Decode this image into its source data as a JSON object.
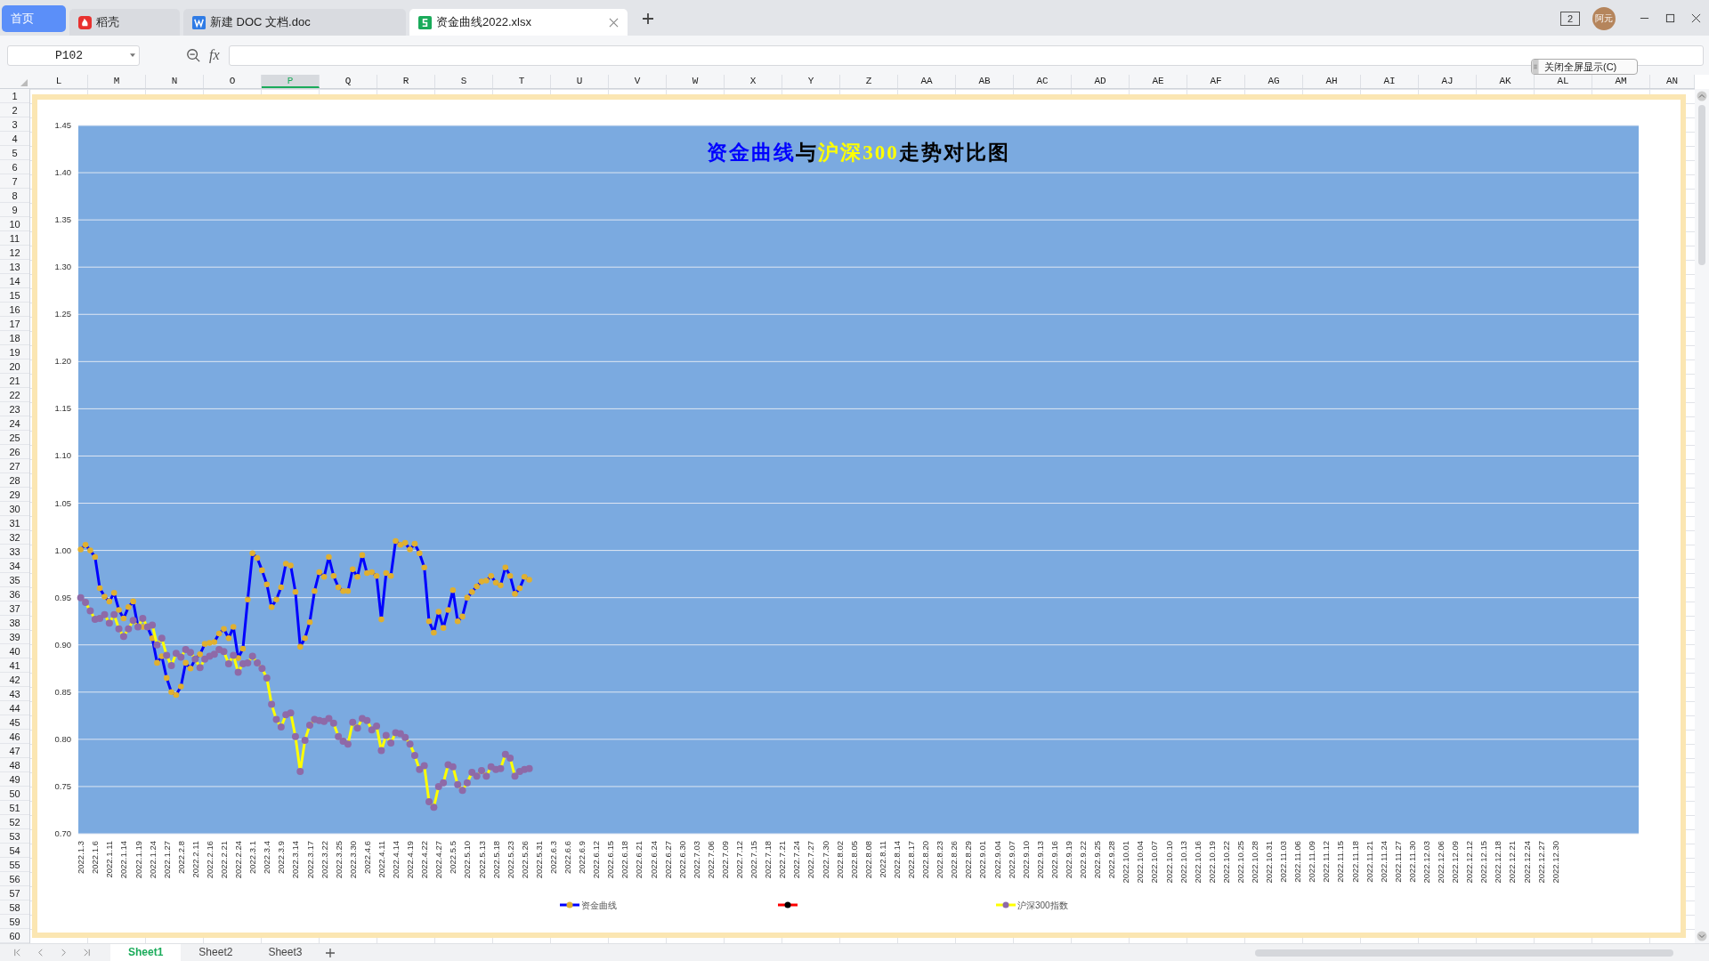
{
  "tabs": [
    {
      "label": "首页",
      "kind": "home",
      "selected": false
    },
    {
      "label": "稻壳",
      "kind": "docer",
      "selected": false
    },
    {
      "label": "新建 DOC 文档.doc",
      "kind": "writer",
      "selected": false
    },
    {
      "label": "资金曲线2022.xlsx",
      "kind": "sheet",
      "selected": true
    }
  ],
  "title_bar": {
    "window_count": "2",
    "user": "阿元"
  },
  "formula_bar": {
    "name_box": "P102",
    "function_label": "fx"
  },
  "popup": {
    "label": "关闭全屏显示(C)"
  },
  "columns": [
    {
      "label": "L",
      "selected": false
    },
    {
      "label": "M",
      "selected": false
    },
    {
      "label": "N",
      "selected": false
    },
    {
      "label": "O",
      "selected": false
    },
    {
      "label": "P",
      "selected": true
    },
    {
      "label": "Q",
      "selected": false
    },
    {
      "label": "R",
      "selected": false
    },
    {
      "label": "S",
      "selected": false
    },
    {
      "label": "T",
      "selected": false
    },
    {
      "label": "U",
      "selected": false
    },
    {
      "label": "V",
      "selected": false
    },
    {
      "label": "W",
      "selected": false
    },
    {
      "label": "X",
      "selected": false
    },
    {
      "label": "Y",
      "selected": false
    },
    {
      "label": "Z",
      "selected": false
    },
    {
      "label": "AA",
      "selected": false
    },
    {
      "label": "AB",
      "selected": false
    },
    {
      "label": "AC",
      "selected": false
    },
    {
      "label": "AD",
      "selected": false
    },
    {
      "label": "AE",
      "selected": false
    },
    {
      "label": "AF",
      "selected": false
    },
    {
      "label": "AG",
      "selected": false
    },
    {
      "label": "AH",
      "selected": false
    },
    {
      "label": "AI",
      "selected": false
    },
    {
      "label": "AJ",
      "selected": false
    },
    {
      "label": "AK",
      "selected": false
    },
    {
      "label": "AL",
      "selected": false
    },
    {
      "label": "AM",
      "selected": false
    },
    {
      "label": "AN",
      "selected": false
    }
  ],
  "rows": [
    "1",
    "2",
    "3",
    "4",
    "5",
    "6",
    "7",
    "8",
    "9",
    "10",
    "11",
    "12",
    "13",
    "14",
    "15",
    "16",
    "17",
    "18",
    "19",
    "20",
    "21",
    "22",
    "23",
    "24",
    "25",
    "26",
    "27",
    "28",
    "29",
    "30",
    "31",
    "32",
    "33",
    "34",
    "35",
    "36",
    "37",
    "38",
    "39",
    "40",
    "41",
    "42",
    "43",
    "44",
    "45",
    "46",
    "47",
    "48",
    "49",
    "50",
    "51",
    "52",
    "53",
    "54",
    "55",
    "56",
    "57",
    "58",
    "59",
    "60"
  ],
  "chart": {
    "title_parts": [
      {
        "text": "资金曲线",
        "color": "#0000ff"
      },
      {
        "text": "与",
        "color": "#000000"
      },
      {
        "text": "沪深300",
        "color": "#ffff00"
      },
      {
        "text": "走势对比图",
        "color": "#000000"
      }
    ],
    "chart_data": {
      "type": "line",
      "grid": true,
      "legend": true,
      "ylim": [
        0.7,
        1.45
      ],
      "yticks": [
        {
          "value": 0.7,
          "label": "0.70"
        },
        {
          "value": 0.75,
          "label": "0.75"
        },
        {
          "value": 0.8,
          "label": "0.80"
        },
        {
          "value": 0.85,
          "label": "0.85"
        },
        {
          "value": 0.9,
          "label": "0.90"
        },
        {
          "value": 0.95,
          "label": "0.95"
        },
        {
          "value": 1.0,
          "label": "1.00"
        },
        {
          "value": 1.05,
          "label": "1.05"
        },
        {
          "value": 1.1,
          "label": "1.10"
        },
        {
          "value": 1.15,
          "label": "1.15"
        },
        {
          "value": 1.2,
          "label": "1.20"
        },
        {
          "value": 1.25,
          "label": "1.25"
        },
        {
          "value": 1.3,
          "label": "1.30"
        },
        {
          "value": 1.35,
          "label": "1.35"
        },
        {
          "value": 1.4,
          "label": "1.40"
        },
        {
          "value": 1.45,
          "label": "1.45"
        }
      ],
      "categories": [
        "2022.1.3",
        null,
        null,
        "2022.1.6",
        null,
        null,
        "2022.1.11",
        null,
        null,
        "2022.1.14",
        null,
        null,
        "2022.1.19",
        null,
        null,
        "2022.1.24",
        null,
        null,
        "2022.1.27",
        null,
        null,
        "2022.2.8",
        null,
        null,
        "2022.2.11",
        null,
        null,
        "2022.2.16",
        null,
        null,
        "2022.2.21",
        null,
        null,
        "2022.2.24",
        null,
        null,
        "2022.3.1",
        null,
        null,
        "2022.3.4",
        null,
        null,
        "2022.3.9",
        null,
        null,
        "2022.3.14",
        null,
        null,
        "2022.3.17",
        null,
        null,
        "2022.3.22",
        null,
        null,
        "2022.3.25",
        null,
        null,
        "2022.3.30",
        null,
        null,
        "2022.4.6",
        null,
        null,
        "2022.4.11",
        null,
        null,
        "2022.4.14",
        null,
        null,
        "2022.4.19",
        null,
        null,
        "2022.4.22",
        null,
        null,
        "2022.4.27",
        null,
        null,
        "2022.5.5",
        null,
        null,
        "2022.5.10",
        null,
        null,
        "2022.5.13",
        null,
        null,
        "2022.5.18",
        null,
        null,
        "2022.5.23",
        null,
        null,
        "2022.5.26",
        null,
        null,
        "2022.5.31",
        null,
        null,
        "2022.6.3",
        null,
        null,
        "2022.6.6",
        null,
        null,
        "2022.6.9",
        null,
        null,
        "2022.6.12",
        null,
        null,
        "2022.6.15",
        null,
        null,
        "2022.6.18",
        null,
        null,
        "2022.6.21",
        null,
        null,
        "2022.6.24",
        null,
        null,
        "2022.6.27",
        null,
        null,
        "2022.6.30",
        null,
        null,
        "2022.7.03",
        null,
        null,
        "2022.7.06",
        null,
        null,
        "2022.7.09",
        null,
        null,
        "2022.7.12",
        null,
        null,
        "2022.7.15",
        null,
        null,
        "2022.7.18",
        null,
        null,
        "2022.7.21",
        null,
        null,
        "2022.7.24",
        null,
        null,
        "2022.7.27",
        null,
        null,
        "2022.7.30",
        null,
        null,
        "2022.8.02",
        null,
        null,
        "2022.8.05",
        null,
        null,
        "2022.8.08",
        null,
        null,
        "2022.8.11",
        null,
        null,
        "2022.8.14",
        null,
        null,
        "2022.8.17",
        null,
        null,
        "2022.8.20",
        null,
        null,
        "2022.8.23",
        null,
        null,
        "2022.8.26",
        null,
        null,
        "2022.8.29",
        null,
        null,
        "2022.9.01",
        null,
        null,
        "2022.9.04",
        null,
        null,
        "2022.9.07",
        null,
        null,
        "2022.9.10",
        null,
        null,
        "2022.9.13",
        null,
        null,
        "2022.9.16",
        null,
        null,
        "2022.9.19",
        null,
        null,
        "2022.9.22",
        null,
        null,
        "2022.9.25",
        null,
        null,
        "2022.9.28",
        null,
        null,
        "2022.10.01",
        null,
        null,
        "2022.10.04",
        null,
        null,
        "2022.10.07",
        null,
        null,
        "2022.10.10",
        null,
        null,
        "2022.10.13",
        null,
        null,
        "2022.10.16",
        null,
        null,
        "2022.10.19",
        null,
        null,
        "2022.10.22",
        null,
        null,
        "2022.10.25",
        null,
        null,
        "2022.10.28",
        null,
        null,
        "2022.10.31",
        null,
        null,
        "2022.11.03",
        null,
        null,
        "2022.11.06",
        null,
        null,
        "2022.11.09",
        null,
        null,
        "2022.11.12",
        null,
        null,
        "2022.11.15",
        null,
        null,
        "2022.11.18",
        null,
        null,
        "2022.11.21",
        null,
        null,
        "2022.11.24",
        null,
        null,
        "2022.11.27",
        null,
        null,
        "2022.11.30",
        null,
        null,
        "2022.12.03",
        null,
        null,
        "2022.12.06",
        null,
        null,
        "2022.12.09",
        null,
        null,
        "2022.12.12",
        null,
        null,
        "2022.12.15",
        null,
        null,
        "2022.12.18",
        null,
        null,
        "2022.12.21",
        null,
        null,
        "2022.12.24",
        null,
        null,
        "2022.12.27",
        null,
        null,
        "2022.12.30",
        null,
        null,
        null,
        null,
        null,
        null,
        null,
        null,
        null,
        null,
        null,
        null,
        null,
        null,
        null,
        null,
        null
      ],
      "series": [
        {
          "name": "资金曲线",
          "color": "#0000ff",
          "marker": "circle",
          "values": [
            1.001,
            1.006,
            1.0,
            0.993,
            0.96,
            0.951,
            0.946,
            0.955,
            0.937,
            0.928,
            0.94,
            0.946,
            0.919,
            0.919,
            0.919,
            0.907,
            0.881,
            0.888,
            0.865,
            0.85,
            0.847,
            0.856,
            0.881,
            0.875,
            0.885,
            0.89,
            0.901,
            0.902,
            0.903,
            0.912,
            0.917,
            0.907,
            0.919,
            0.886,
            0.896,
            0.948,
            0.997,
            0.992,
            0.979,
            0.964,
            0.94,
            0.948,
            0.961,
            0.986,
            0.984,
            0.956,
            0.898,
            0.907,
            0.924,
            0.957,
            0.977,
            0.972,
            0.993,
            0.973,
            0.961,
            0.957,
            0.957,
            0.98,
            0.972,
            0.995,
            0.976,
            0.977,
            0.973,
            0.927,
            0.976,
            0.973,
            1.01,
            1.006,
            1.008,
            1.001,
            1.007,
            0.997,
            0.982,
            0.925,
            0.913,
            0.935,
            0.918,
            0.937,
            0.958,
            0.925,
            0.93,
            0.95,
            0.956,
            0.962,
            0.967,
            0.968,
            0.973,
            0.966,
            0.963,
            0.982,
            0.973,
            0.954,
            0.96,
            0.972,
            0.969,
            null,
            null,
            null,
            null,
            null,
            null,
            null,
            null,
            null,
            null,
            null,
            null,
            null,
            null,
            null,
            null,
            null,
            null,
            null,
            null,
            null,
            null,
            null,
            null,
            null,
            null,
            null,
            null,
            null,
            null,
            null,
            null,
            null,
            null,
            null,
            null,
            null,
            null,
            null,
            null,
            null,
            null,
            null,
            null,
            null,
            null,
            null,
            null,
            null,
            null,
            null,
            null,
            null,
            null,
            null,
            null,
            null,
            null,
            null,
            null,
            null,
            null,
            null,
            null,
            null,
            null,
            null,
            null,
            null,
            null,
            null,
            null,
            null,
            null,
            null,
            null,
            null,
            null,
            null,
            null,
            null,
            null,
            null,
            null,
            null,
            null,
            null,
            null,
            null,
            null,
            null,
            null,
            null,
            null,
            null,
            null,
            null,
            null,
            null,
            null,
            null,
            null,
            null,
            null,
            null,
            null,
            null,
            null,
            null,
            null,
            null,
            null,
            null,
            null,
            null,
            null,
            null,
            null,
            null,
            null,
            null,
            null,
            null,
            null,
            null,
            null,
            null,
            null,
            null,
            null,
            null,
            null,
            null,
            null,
            null,
            null,
            null,
            null,
            null,
            null,
            null,
            null,
            null,
            null,
            null,
            null,
            null,
            null,
            null,
            null,
            null,
            null,
            null,
            null,
            null,
            null,
            null,
            null,
            null,
            null,
            null,
            null,
            null,
            null,
            null,
            null,
            null,
            null,
            null,
            null,
            null,
            null,
            null,
            null,
            null,
            null,
            null,
            null,
            null,
            null,
            null,
            null,
            null,
            null,
            null,
            null,
            null,
            null,
            null,
            null,
            null,
            null,
            null,
            null,
            null,
            null,
            null,
            null,
            null,
            null,
            null,
            null,
            null,
            null,
            null,
            null,
            null,
            null,
            null,
            null,
            null,
            null,
            null,
            null,
            null,
            null,
            null,
            null,
            null,
            null,
            null,
            null,
            null,
            null,
            null,
            null,
            null,
            null,
            null,
            null,
            null,
            null
          ]
        },
        {
          "color": "#ff0000",
          "marker": "circle",
          "values": [
            null,
            null,
            null,
            null,
            null,
            null,
            null,
            null,
            null,
            null,
            null,
            null,
            null,
            null,
            null,
            null,
            null,
            null,
            null,
            null,
            null,
            null,
            null,
            null,
            null,
            null,
            null,
            null,
            null,
            null,
            null,
            null,
            null,
            null,
            null,
            null,
            null,
            null,
            null,
            null,
            null,
            null,
            null,
            null,
            null,
            null,
            null,
            null,
            null,
            null,
            null,
            null,
            null,
            null,
            null,
            null,
            null,
            null,
            null,
            null,
            null,
            null,
            null,
            null,
            null,
            null,
            null,
            null,
            null,
            null,
            null,
            null,
            null,
            null,
            null,
            null,
            null,
            null,
            null,
            null,
            null,
            null,
            null,
            null,
            null,
            null,
            null,
            null,
            null,
            null,
            null,
            null,
            null,
            null,
            null,
            null,
            null,
            null,
            null,
            null,
            null,
            null,
            null,
            null,
            null,
            null,
            null,
            null,
            null,
            null,
            null,
            null,
            null,
            null,
            null,
            null,
            null,
            null,
            null,
            null,
            null,
            null,
            null,
            null,
            null,
            null,
            null,
            null,
            null,
            null,
            null,
            null,
            null,
            null,
            null,
            null,
            null,
            null,
            null,
            null,
            null,
            null,
            null,
            null,
            null,
            null,
            null,
            null,
            null,
            null,
            null,
            null,
            null,
            null,
            null,
            null,
            null,
            null,
            null,
            null,
            null,
            null,
            null,
            null,
            null,
            null,
            null,
            null,
            null,
            null,
            null,
            null,
            null,
            null,
            null,
            null,
            null,
            null,
            null,
            null,
            null,
            null,
            null,
            null,
            null,
            null,
            null,
            null,
            null,
            null,
            null,
            null,
            null,
            null,
            null,
            null,
            null,
            null,
            null,
            null,
            null,
            null,
            null,
            null,
            null,
            null,
            null,
            null,
            null,
            null,
            null,
            null,
            null,
            null,
            null,
            null,
            null,
            null,
            null,
            null,
            null,
            null,
            null,
            null,
            null,
            null,
            null,
            null,
            null,
            null,
            null,
            null,
            null,
            null,
            null,
            null,
            null,
            null,
            null,
            null,
            null,
            null,
            null,
            null,
            null,
            null,
            null,
            null,
            null,
            null,
            null,
            null,
            null,
            null,
            null,
            null,
            null,
            null,
            null,
            null,
            null,
            null,
            null,
            null,
            null,
            null,
            null,
            null,
            null,
            null,
            null,
            null,
            null,
            null,
            null,
            null,
            null,
            null,
            null,
            null,
            null,
            null,
            null,
            null,
            null,
            null,
            null,
            null,
            null,
            null,
            null,
            null,
            null,
            null,
            null,
            null,
            null,
            null,
            null,
            null,
            null,
            null,
            null,
            null,
            null,
            null,
            null,
            null,
            null,
            null,
            null,
            null,
            null,
            null,
            null,
            null,
            null,
            null,
            null,
            null,
            null,
            null,
            null,
            null,
            null,
            null,
            null
          ]
        },
        {
          "name": "沪深300指数",
          "color": "#ffff00",
          "marker": "circle",
          "values": [
            0.95,
            0.945,
            0.936,
            0.927,
            0.928,
            0.932,
            0.923,
            0.932,
            0.917,
            0.909,
            0.917,
            0.926,
            0.919,
            0.928,
            0.919,
            0.921,
            0.9,
            0.907,
            0.889,
            0.878,
            0.891,
            0.887,
            0.895,
            0.892,
            0.885,
            0.876,
            0.885,
            0.888,
            0.89,
            0.895,
            0.893,
            0.88,
            0.889,
            0.871,
            0.88,
            0.881,
            0.888,
            0.881,
            0.875,
            0.865,
            0.837,
            0.821,
            0.813,
            0.826,
            0.828,
            0.803,
            0.766,
            0.799,
            0.815,
            0.821,
            0.82,
            0.819,
            0.822,
            0.817,
            0.803,
            0.798,
            0.795,
            0.818,
            0.812,
            0.822,
            0.82,
            0.81,
            0.814,
            0.788,
            0.804,
            0.796,
            0.807,
            0.806,
            0.802,
            0.795,
            0.783,
            0.768,
            0.772,
            0.734,
            0.728,
            0.75,
            0.754,
            0.773,
            0.771,
            0.752,
            0.746,
            0.754,
            0.765,
            0.761,
            0.767,
            0.761,
            0.771,
            0.768,
            0.769,
            0.784,
            0.78,
            0.761,
            0.766,
            0.768,
            0.769,
            null,
            null,
            null,
            null,
            null,
            null,
            null,
            null,
            null,
            null,
            null,
            null,
            null,
            null,
            null,
            null,
            null,
            null,
            null,
            null,
            null,
            null,
            null,
            null,
            null,
            null,
            null,
            null,
            null,
            null,
            null,
            null,
            null,
            null,
            null,
            null,
            null,
            null,
            null,
            null,
            null,
            null,
            null,
            null,
            null,
            null,
            null,
            null,
            null,
            null,
            null,
            null,
            null,
            null,
            null,
            null,
            null,
            null,
            null,
            null,
            null,
            null,
            null,
            null,
            null,
            null,
            null,
            null,
            null,
            null,
            null,
            null,
            null,
            null,
            null,
            null,
            null,
            null,
            null,
            null,
            null,
            null,
            null,
            null,
            null,
            null,
            null,
            null,
            null,
            null,
            null,
            null,
            null,
            null,
            null,
            null,
            null,
            null,
            null,
            null,
            null,
            null,
            null,
            null,
            null,
            null,
            null,
            null,
            null,
            null,
            null,
            null,
            null,
            null,
            null,
            null,
            null,
            null,
            null,
            null,
            null,
            null,
            null,
            null,
            null,
            null,
            null,
            null,
            null,
            null,
            null,
            null,
            null,
            null,
            null,
            null,
            null,
            null,
            null,
            null,
            null,
            null,
            null,
            null,
            null,
            null,
            null,
            null,
            null,
            null,
            null,
            null,
            null,
            null,
            null,
            null,
            null,
            null,
            null,
            null,
            null,
            null,
            null,
            null,
            null,
            null,
            null,
            null,
            null,
            null,
            null,
            null,
            null,
            null,
            null,
            null,
            null,
            null,
            null,
            null,
            null,
            null,
            null,
            null,
            null,
            null,
            null,
            null,
            null,
            null,
            null,
            null,
            null,
            null,
            null,
            null,
            null,
            null,
            null,
            null,
            null,
            null,
            null,
            null,
            null,
            null,
            null,
            null,
            null,
            null,
            null,
            null,
            null,
            null,
            null,
            null,
            null,
            null,
            null,
            null,
            null,
            null,
            null,
            null,
            null,
            null,
            null,
            null,
            null,
            null,
            null,
            null
          ]
        }
      ]
    }
  },
  "sheet_tabs": [
    {
      "label": "Sheet1",
      "selected": true
    },
    {
      "label": "Sheet2",
      "selected": false
    },
    {
      "label": "Sheet3",
      "selected": false
    }
  ]
}
